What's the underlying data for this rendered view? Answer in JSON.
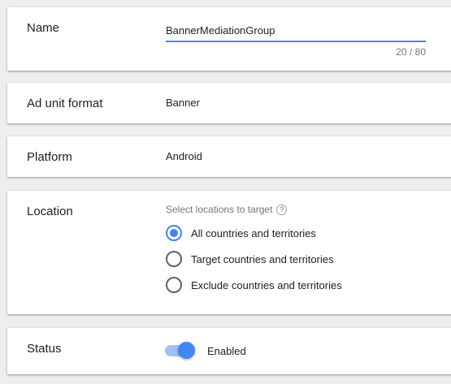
{
  "name_section": {
    "label": "Name",
    "value": "BannerMediationGroup",
    "counter": "20 / 80"
  },
  "format_section": {
    "label": "Ad unit format",
    "value": "Banner"
  },
  "platform_section": {
    "label": "Platform",
    "value": "Android"
  },
  "location_section": {
    "label": "Location",
    "hint": "Select locations to target",
    "help_icon": "help-circle-icon",
    "options": [
      {
        "label": "All countries and territories",
        "selected": true
      },
      {
        "label": "Target countries and territories",
        "selected": false
      },
      {
        "label": "Exclude countries and territories",
        "selected": false
      }
    ]
  },
  "status_section": {
    "label": "Status",
    "toggle_label": "Enabled",
    "enabled": true
  },
  "colors": {
    "accent": "#4285f4",
    "toggle_track": "#9fc1f7",
    "background": "#eeeeee"
  }
}
